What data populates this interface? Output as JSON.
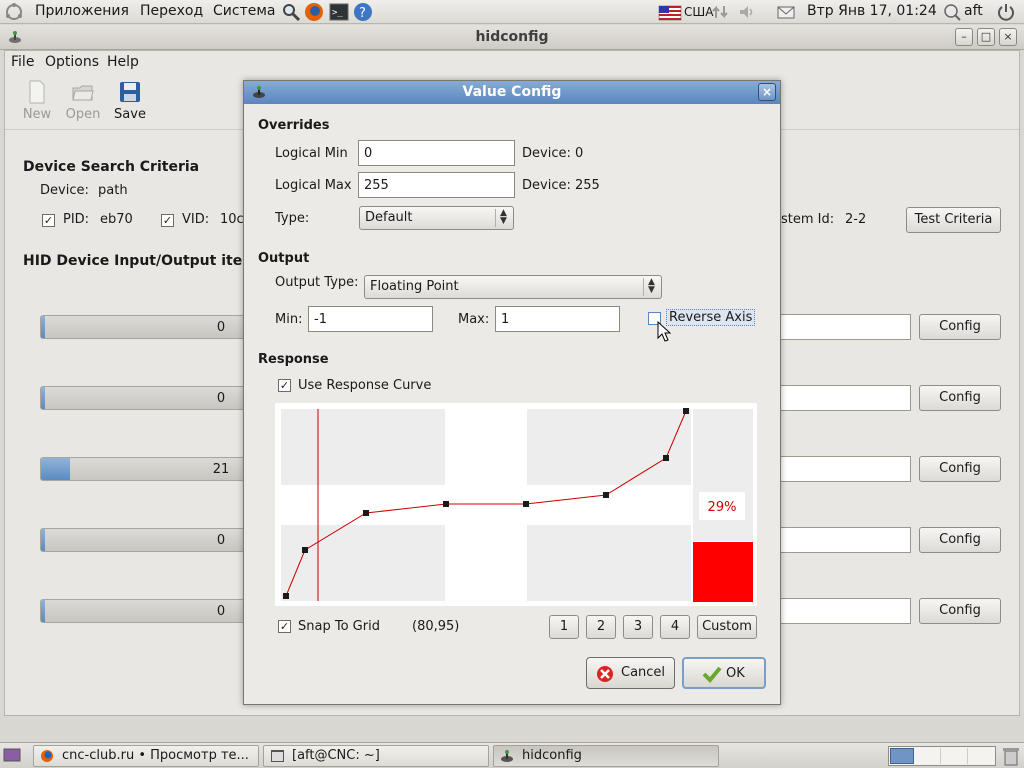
{
  "top_panel": {
    "menus": [
      "Приложения",
      "Переход",
      "Система"
    ],
    "keyboard_layout": "США",
    "clock": "Втр Янв 17, 01:24",
    "user": "aft"
  },
  "main_window": {
    "title": "hidconfig",
    "menu": [
      "File",
      "Options",
      "Help"
    ],
    "toolbar": {
      "new": "New",
      "open": "Open",
      "save": "Save"
    },
    "search_criteria_title": "Device Search Criteria",
    "device_label": "Device:",
    "device_value": "path",
    "pid_label": "PID:",
    "pid_value": "eb70",
    "vid_label": "VID:",
    "vid_value": "10c",
    "system_id_label": "stem Id:",
    "system_id_value": "2-2",
    "test_criteria": "Test Criteria",
    "io_title": "HID Device Input/Output items",
    "items": [
      {
        "value": "0",
        "fill": 0.01,
        "config": "Config"
      },
      {
        "value": "0",
        "fill": 0.01,
        "config": "Config"
      },
      {
        "value": "21",
        "fill": 0.08,
        "config": "Config"
      },
      {
        "value": "0",
        "fill": 0.01,
        "config": "Config"
      },
      {
        "value": "0",
        "fill": 0.01,
        "config": "Config"
      }
    ]
  },
  "dialog": {
    "title": "Value Config",
    "overrides_title": "Overrides",
    "logical_min_label": "Logical Min",
    "logical_min_value": "0",
    "logical_min_device": "Device: 0",
    "logical_max_label": "Logical Max",
    "logical_max_value": "255",
    "logical_max_device": "Device: 255",
    "type_label": "Type:",
    "type_value": "Default",
    "output_title": "Output",
    "output_type_label": "Output Type:",
    "output_type_value": "Floating Point",
    "min_label": "Min:",
    "min_value": "-1",
    "max_label": "Max:",
    "max_value": "1",
    "reverse_axis": "Reverse Axis",
    "response_title": "Response",
    "use_response_curve": "Use Response Curve",
    "percent": "29%",
    "snap_to_grid": "Snap To Grid",
    "coords": "(80,95)",
    "preset_buttons": [
      "1",
      "2",
      "3",
      "4"
    ],
    "custom": "Custom",
    "cancel": "Cancel",
    "ok": "OK"
  },
  "taskbar": {
    "tasks": [
      "cnc-club.ru • Просмотр те...",
      "[aft@CNC: ~]",
      "hidconfig"
    ]
  },
  "colors": {
    "accent": "#5b86bd",
    "curve": "#cc0000",
    "indicator": "#ff0000"
  }
}
